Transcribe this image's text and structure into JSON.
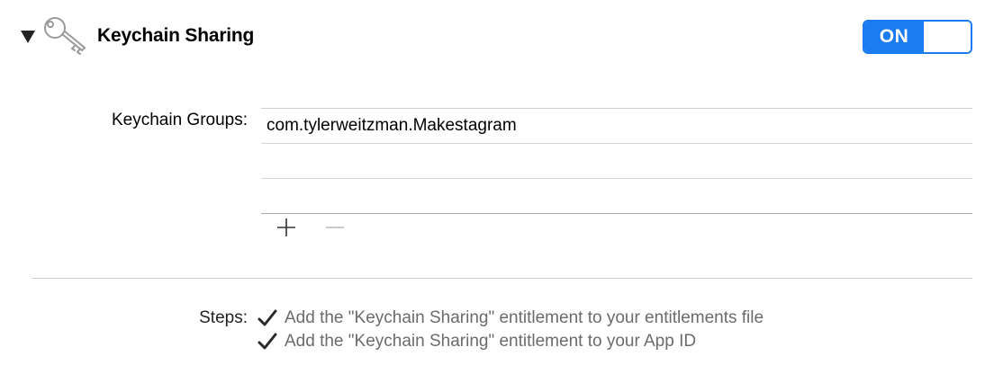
{
  "header": {
    "title": "Keychain Sharing",
    "icon": "key-icon",
    "disclosure_icon": "triangle-down-icon"
  },
  "toggle": {
    "label": "ON",
    "state": "on",
    "accent_color": "#1a7cf0"
  },
  "keychain_groups": {
    "label": "Keychain Groups:",
    "items": [
      "com.tylerweitzman.Makestagram",
      "",
      ""
    ],
    "add_icon": "plus-icon",
    "remove_icon": "minus-icon"
  },
  "steps": {
    "label": "Steps:",
    "items": [
      {
        "text": "Add the \"Keychain Sharing\" entitlement to your entitlements file",
        "status": "done",
        "icon": "checkmark-icon"
      },
      {
        "text": "Add the \"Keychain Sharing\" entitlement to your App ID",
        "status": "done",
        "icon": "checkmark-icon"
      }
    ]
  }
}
